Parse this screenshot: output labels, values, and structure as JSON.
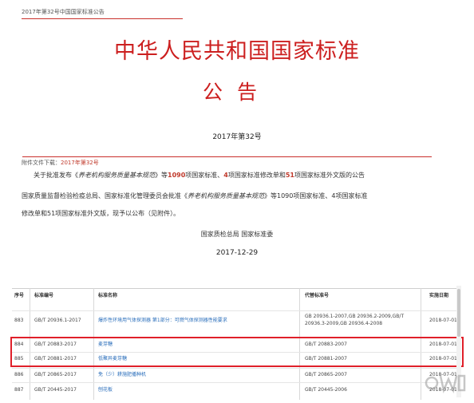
{
  "breadcrumb": "2017年第32号中国国家标准公告",
  "title": "中华人民共和国国家标准",
  "subtitle": "公告",
  "doc_number": "2017年第32号",
  "attachment": {
    "label": "附件文件下载：",
    "link": "2017年第32号"
  },
  "about": {
    "pre": "关于批准发布《",
    "book": "养老机构服务质量基本规范",
    "mid": "》等",
    "n1": "1090",
    "mid2": "项国家标准、",
    "n2": "4",
    "mid3": "项国家标准修改单和",
    "n3": "51",
    "post": "项国家标准外文版的公告"
  },
  "body": {
    "l1_pre": "国家质量监督检验检疫总局、国家标准化管理委员会批准《",
    "l1_book": "养老机构服务质量基本规范",
    "l1_post": "》等1090项国家标准、4项国家标准",
    "l2": "修改单和51项国家标准外文版，现予以公布（见附件）。"
  },
  "signature": "国家质检总局  国家标准委",
  "date": "2017-12-29",
  "table": {
    "headers": [
      "序号",
      "标准编号",
      "标准名称",
      "代替标准号",
      "实施日期"
    ],
    "rows": [
      {
        "no": "883",
        "code": "GB/T 20936.1-2017",
        "name": "爆炸性环境用气体探测器 第1部分：可燃气体探测器性能要求",
        "replace1": "GB 20936.1-2007,GB 20936.2-2009,GB/T",
        "replace2": "20936.3-2009,GB 20936.4-2008",
        "date": "2018-07-01"
      },
      {
        "no": "884",
        "code": "GB/T 20883-2017",
        "name": "麦芽糖",
        "replace1": "GB/T 20883-2007",
        "replace2": "",
        "date": "2018-07-01"
      },
      {
        "no": "885",
        "code": "GB/T 20881-2017",
        "name": "低聚异麦芽糖",
        "replace1": "GB/T 20881-2007",
        "replace2": "",
        "date": "2018-07-01"
      },
      {
        "no": "886",
        "code": "GB/T 20865-2017",
        "name": "免（少）耕施肥播种机",
        "replace1": "GB/T 20865-2007",
        "replace2": "",
        "date": "2018-07-01"
      },
      {
        "no": "887",
        "code": "GB/T 20445-2017",
        "name": "刨花板",
        "replace1": "GB/T 20445-2006",
        "replace2": "",
        "date": "2018-07-01"
      }
    ]
  },
  "watermark": "蜗玩",
  "colors": {
    "accent_red": "#cc1f1f",
    "highlight_box": "#e0202a",
    "link_blue": "#2a6ebb"
  }
}
